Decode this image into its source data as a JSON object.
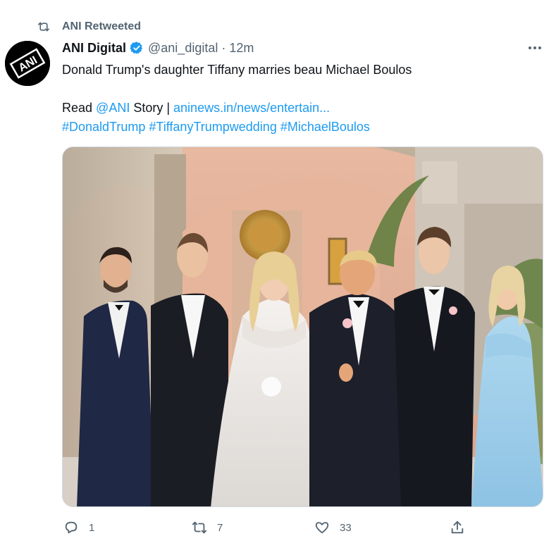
{
  "retweet": {
    "label": "ANI Retweeted"
  },
  "author": {
    "name": "ANI Digital",
    "handle": "@ani_digital",
    "separator": "·",
    "time": "12m",
    "avatar_text": "ANI"
  },
  "tweet": {
    "line1": "Donald Trump's daughter Tiffany marries beau Michael Boulos",
    "read_prefix": "Read ",
    "mention": "@ANI",
    "story_text": " Story | ",
    "link_text": "aninews.in/news/entertain...",
    "hashtags": [
      "#DonaldTrump",
      "#TiffanyTrumpwedding",
      "#MichaelBoulos"
    ]
  },
  "actions": {
    "reply_count": "1",
    "retweet_count": "7",
    "like_count": "33"
  },
  "colors": {
    "link": "#1d9bf0",
    "secondary": "#536471",
    "verified": "#1d9bf0"
  }
}
